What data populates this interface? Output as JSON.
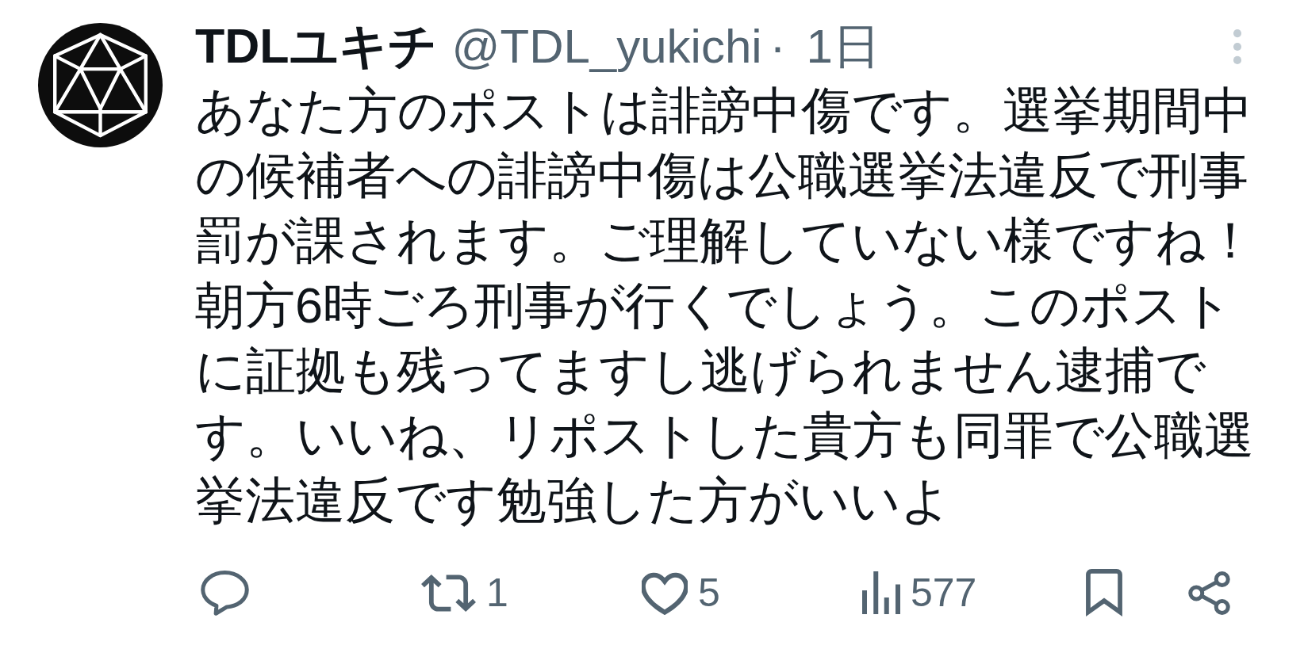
{
  "post": {
    "author": {
      "name": "TDLユキチ",
      "handle": "@TDL_yukichi"
    },
    "separator": "·",
    "time": "1日",
    "text": "あなた方のポストは誹謗中傷です。選挙期間中の候補者への誹謗中傷は公職選挙法違反で刑事罰が課されます。ご理解していない様ですね！朝方6時ごろ刑事が行くでしょう。このポストに証拠も残ってますし逃げられません逮捕です。いいね、リポストした貴方も同罪で公職選挙法違反です勉強した方がいいよ",
    "actions": [
      {
        "kind": "reply"
      },
      {
        "kind": "repost",
        "count": "1"
      },
      {
        "kind": "like",
        "count": "5"
      },
      {
        "kind": "views",
        "count": "577"
      },
      {
        "kind": "bookmark"
      },
      {
        "kind": "share"
      }
    ]
  }
}
